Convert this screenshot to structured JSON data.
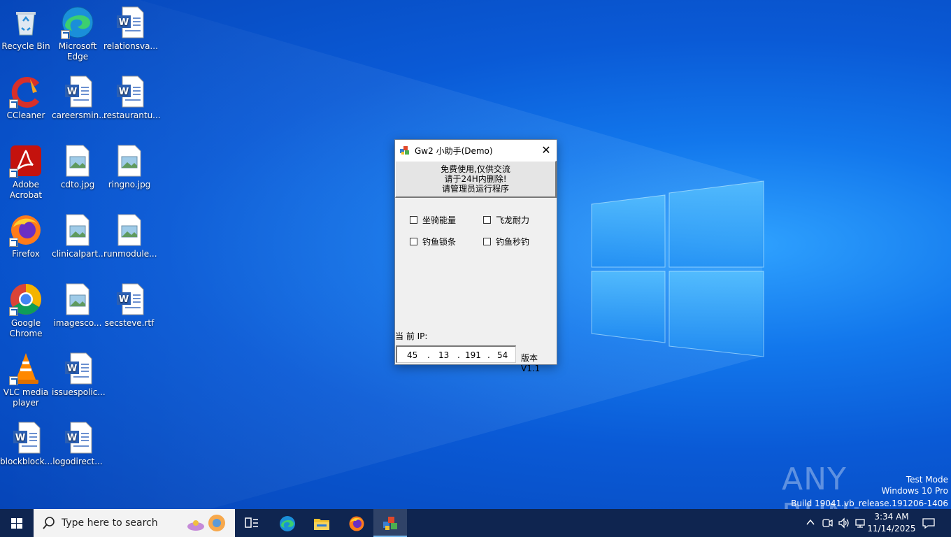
{
  "desktop": {
    "icons": [
      {
        "label": "Recycle Bin",
        "icon": "recycle-bin-icon"
      },
      {
        "label": "Microsoft Edge",
        "icon": "edge-icon"
      },
      {
        "label": "relationsva...",
        "icon": "word-doc-icon"
      },
      {
        "label": "CCleaner",
        "icon": "ccleaner-icon"
      },
      {
        "label": "careersmin...",
        "icon": "word-doc-icon"
      },
      {
        "label": "restaurantu...",
        "icon": "word-doc-icon"
      },
      {
        "label": "Adobe Acrobat",
        "icon": "acrobat-icon"
      },
      {
        "label": "cdto.jpg",
        "icon": "image-file-icon"
      },
      {
        "label": "ringno.jpg",
        "icon": "image-file-icon"
      },
      {
        "label": "Firefox",
        "icon": "firefox-icon"
      },
      {
        "label": "clinicalpart...",
        "icon": "image-file-icon"
      },
      {
        "label": "runmodule...",
        "icon": "image-file-icon"
      },
      {
        "label": "Google Chrome",
        "icon": "chrome-icon"
      },
      {
        "label": "imagesco...",
        "icon": "image-file-icon"
      },
      {
        "label": "secsteve.rtf",
        "icon": "word-doc-icon"
      },
      {
        "label": "VLC media player",
        "icon": "vlc-icon"
      },
      {
        "label": "issuespolic...",
        "icon": "word-doc-icon"
      },
      {
        "label": "blockblock...",
        "icon": "word-doc-icon"
      },
      {
        "label": "logodirect...",
        "icon": "word-doc-icon"
      }
    ]
  },
  "window": {
    "title": "Gw2 小助手(Demo)",
    "close_glyph": "✕",
    "notice_lines": [
      "免费使用,仅供交流",
      "请于24H内删除!",
      "请管理员运行程序"
    ],
    "checkboxes": [
      {
        "label": "坐骑能量",
        "checked": false
      },
      {
        "label": "飞龙耐力",
        "checked": false
      },
      {
        "label": "钓鱼锁条",
        "checked": false
      },
      {
        "label": "钓鱼秒钓",
        "checked": false
      }
    ],
    "ip_label": "当 前 IP:",
    "ip_octets": [
      "45",
      "13",
      "191",
      "54"
    ],
    "ip_separator": ".",
    "version": "版本V1.1"
  },
  "taskbar": {
    "search_placeholder": "Type here to search",
    "time": "3:34 AM",
    "date": "11/14/2025",
    "pinned": [
      "task-view-icon",
      "edge-icon",
      "file-explorer-icon",
      "firefox-icon",
      "app-icon"
    ]
  },
  "watermark": {
    "brand": "ANY RUN",
    "mode": "Test Mode",
    "os": "Windows 10 Pro",
    "build": "Build 19041.vb_release.191206-1406"
  },
  "colors": {
    "taskbar": "#0f2550",
    "accent": "#76b9ed",
    "wallpaper": "#0a5ad6"
  }
}
